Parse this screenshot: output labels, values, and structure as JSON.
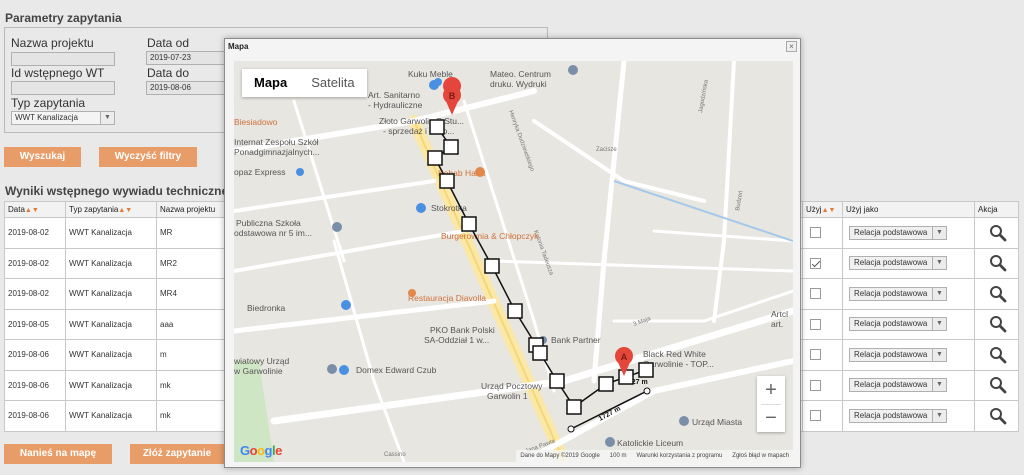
{
  "filters": {
    "title": "Parametry zapytania",
    "project_name_label": "Nazwa projektu",
    "project_name_value": "",
    "prelim_id_label": "Id wstępnego WT",
    "prelim_id_value": "",
    "query_type_label": "Typ zapytania",
    "query_type_value": "WWT Kanalizacja",
    "date_from_label": "Data od",
    "date_from_value": "2019-07-23",
    "date_to_label": "Data do",
    "date_to_value": "2019-08-06",
    "search_button": "Wyszukaj",
    "clear_button": "Wyczyść filtry"
  },
  "results": {
    "title": "Wyniki wstępnego wywiadu technicznego",
    "columns": {
      "date": "Data",
      "type": "Typ zapytania",
      "project": "Nazwa projektu",
      "use": "Użyj",
      "use_as": "Użyj jako",
      "action": "Akcja"
    },
    "rows": [
      {
        "date": "2019-08-02",
        "type": "WWT Kanalizacja",
        "project": "MR",
        "checked": false,
        "use_as": "Relacja podstawowa"
      },
      {
        "date": "2019-08-02",
        "type": "WWT Kanalizacja",
        "project": "MR2",
        "checked": true,
        "use_as": "Relacja podstawowa"
      },
      {
        "date": "2019-08-02",
        "type": "WWT Kanalizacja",
        "project": "MR4",
        "checked": false,
        "use_as": "Relacja podstawowa"
      },
      {
        "date": "2019-08-05",
        "type": "WWT Kanalizacja",
        "project": "aaa",
        "checked": false,
        "use_as": "Relacja podstawowa"
      },
      {
        "date": "2019-08-06",
        "type": "WWT Kanalizacja",
        "project": "m",
        "checked": false,
        "use_as": "Relacja podstawowa"
      },
      {
        "date": "2019-08-06",
        "type": "WWT Kanalizacja",
        "project": "mk",
        "checked": false,
        "use_as": "Relacja podstawowa"
      },
      {
        "date": "2019-08-06",
        "type": "WWT Kanalizacja",
        "project": "mk",
        "checked": false,
        "use_as": "Relacja podstawowa"
      }
    ],
    "plot_button": "Nanieś na mapę",
    "submit_button": "Złóż zapytanie"
  },
  "map_modal": {
    "title": "Mapa",
    "close": "×",
    "tab_map": "Mapa",
    "tab_satellite": "Satelita",
    "zoom_in": "+",
    "zoom_out": "−",
    "logo": "Google",
    "attribution": "Dane do Mapy ©2019 Google",
    "scale": "100 m",
    "terms": "Warunki korzystania z programu",
    "report": "Zgłoś błąd w mapach",
    "distance_1": "1727 m",
    "distance_2": "1727 m",
    "pois": {
      "sanitarno": "Art. Sanitarno",
      "hydraulic": "- Hydrauliczne",
      "mebel": "Kuku Meble",
      "mateo1": "Mateo. Centrum",
      "mateo2": "druku. Wydruki",
      "zloto1": "Złoto Garwolin S.Stu...",
      "zloto2": "- sprzedaż i skup...",
      "siedlowo": "Biesiadowo",
      "internat1": "Internat Zespołu Szkół",
      "internat2": "Ponadgimnazjalnych...",
      "express": "opaz Express",
      "kebab": "Kebab Haba",
      "stokrotka": "Stokrotka",
      "publiczna1": "Publiczna Szkoła",
      "publiczna2": "odstawowa nr 5 im...",
      "burgerownia": "Burgerownia & Chłopczyk",
      "biedronka": "Biedronka",
      "restauracja": "Restauracja Diavolla",
      "pko1": "PKO Bank Polski",
      "pko2": "SA-Oddział 1 w...",
      "bankpartner": "Bank Partner",
      "blackred1": "Black Red White",
      "blackred2": "Garwolinie - TOP...",
      "urzad1": "wiatowy Urząd",
      "urzad2": "w Garwolinie",
      "domex": "Domex Edward Czub",
      "poczta1": "Urząd Pocztowy",
      "poczta2": "Garwolin 1",
      "urzadmiasta": "Urząd Miasta",
      "liceum": "Katolickie Liceum",
      "artcl": "Artcl",
      "art": "art.",
      "jagodzinska": "Jagodzińska",
      "zacisze": "Zacisze",
      "budzen": "Budzeń",
      "maja": "3 Maja",
      "jana": "Jana Pawła",
      "henryka": "Henryka Dudziewskiego",
      "kolonia": "Kolonia Tadeusza",
      "cassino": "Cassino"
    }
  }
}
